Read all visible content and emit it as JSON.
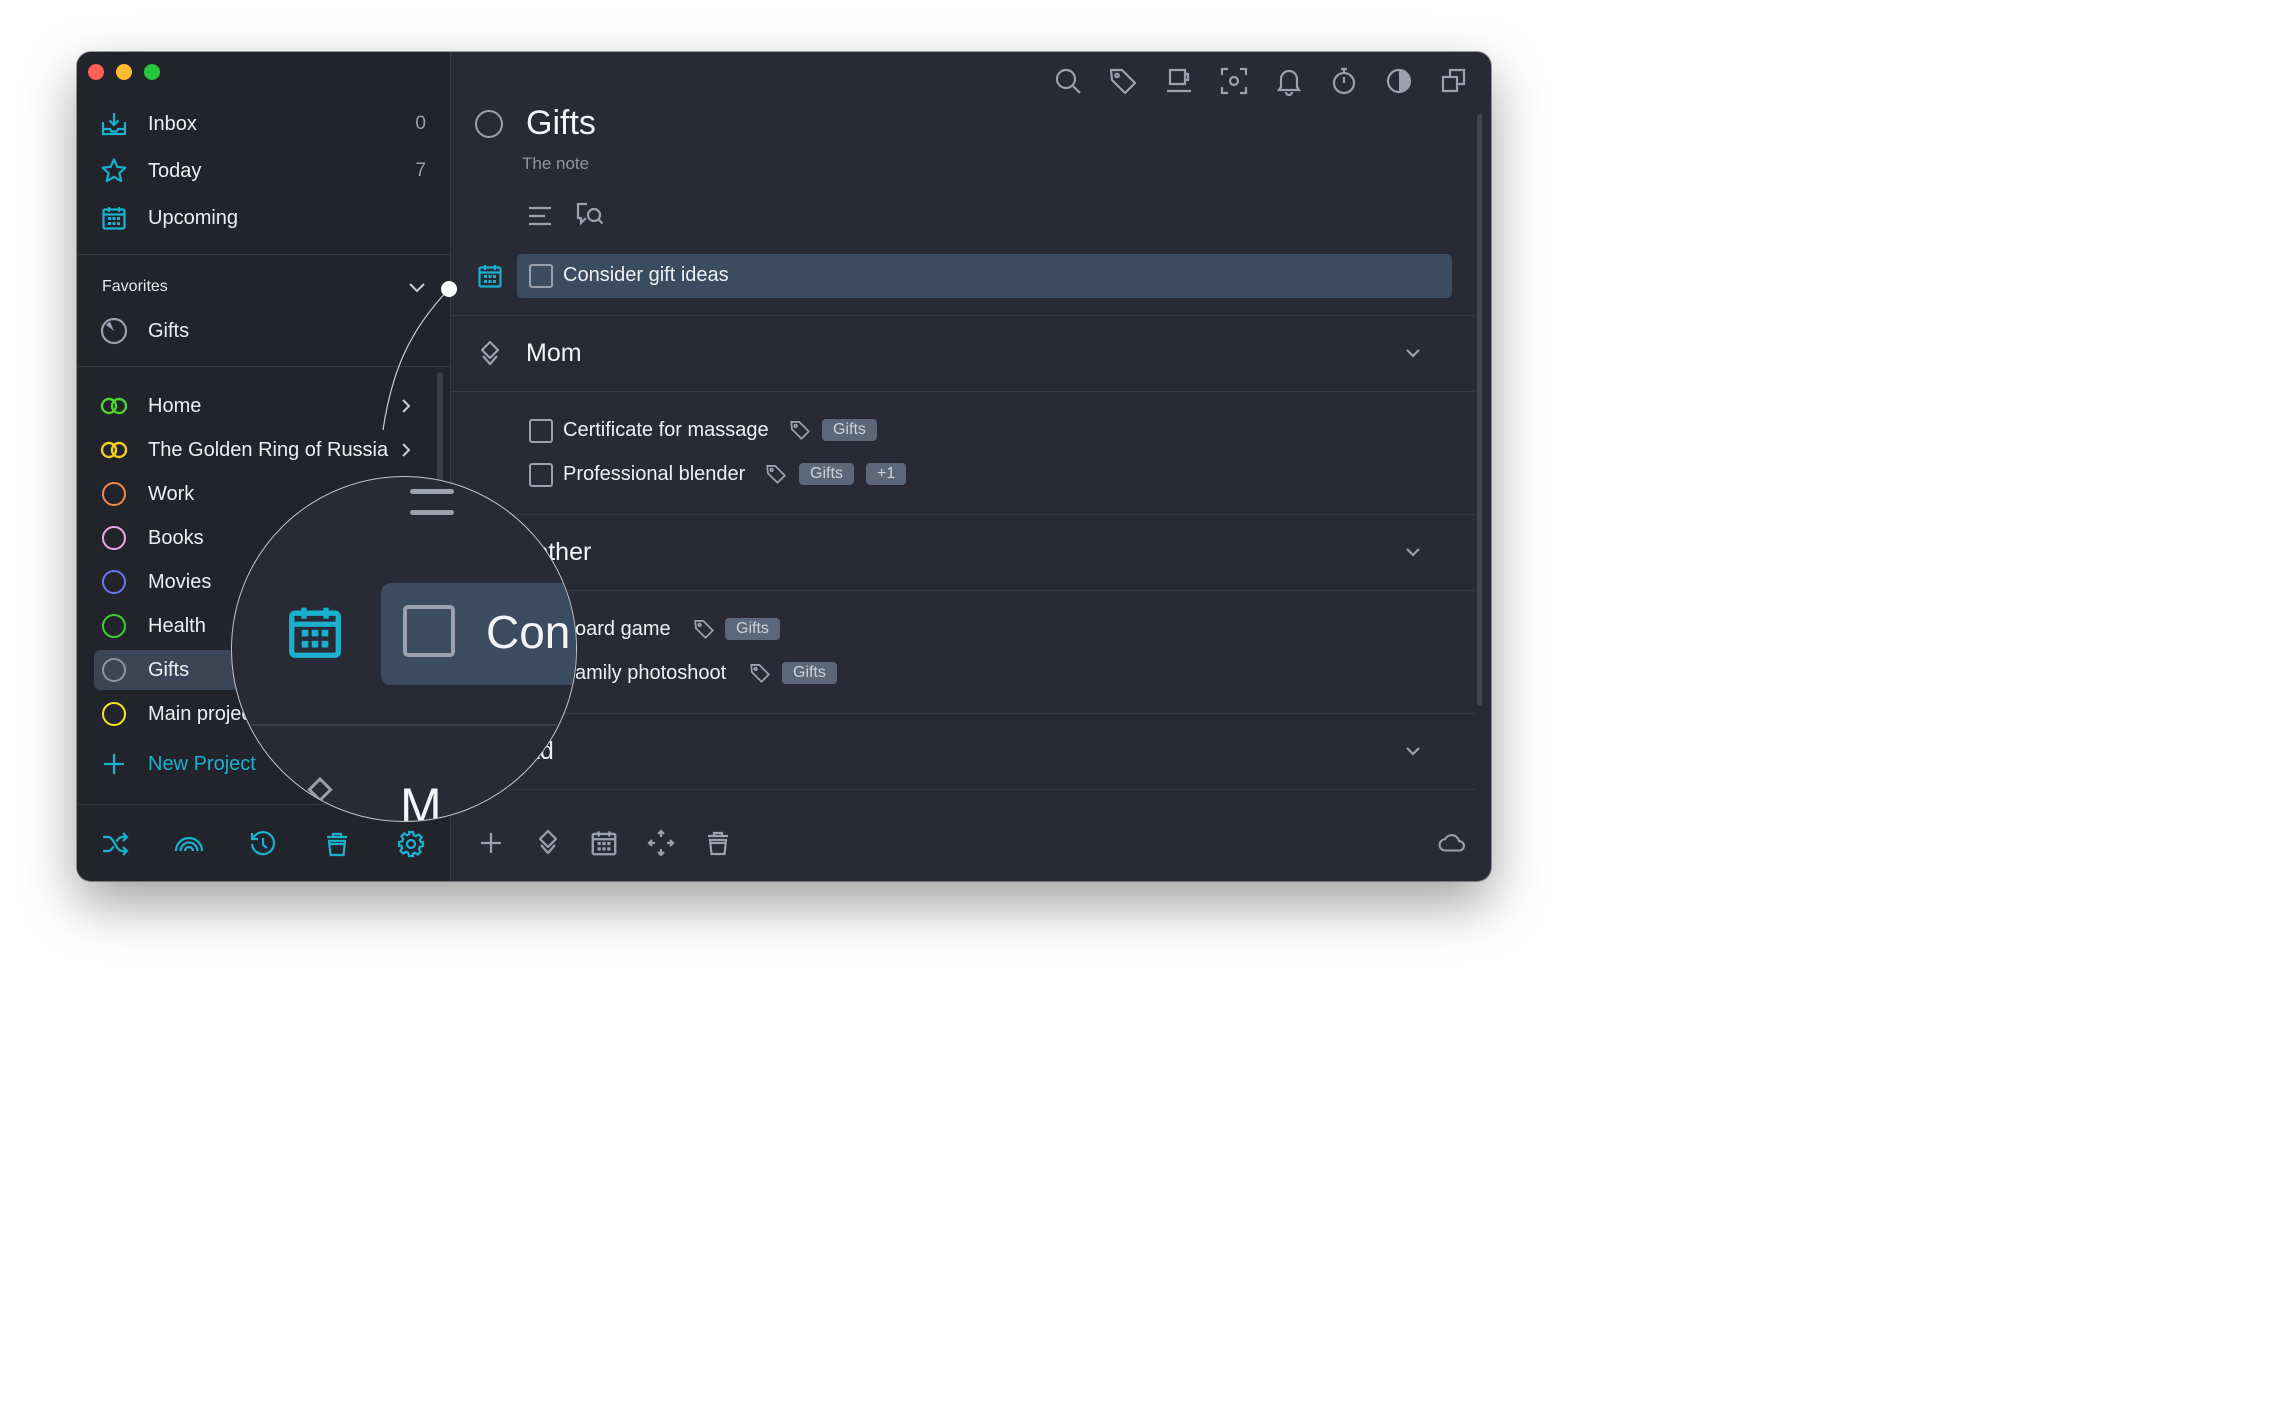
{
  "sidebar": {
    "inbox": {
      "label": "Inbox",
      "count": "0",
      "icon": "inbox-tray-icon"
    },
    "today": {
      "label": "Today",
      "count": "7",
      "icon": "star-icon"
    },
    "upcoming": {
      "label": "Upcoming",
      "icon": "calendar-icon"
    },
    "favorites_title": "Favorites",
    "favorites": [
      {
        "label": "Gifts",
        "icon": "progress-ring-icon"
      }
    ],
    "projects": [
      {
        "label": "Home",
        "icon": "area-rings-icon",
        "color": "#4fd12e"
      },
      {
        "label": "The Golden Ring of Russia",
        "icon": "area-rings-icon",
        "color": "#f3cc21"
      },
      {
        "label": "Work",
        "icon": "project-ring-icon",
        "color": "#f08a4b"
      },
      {
        "label": "Books",
        "icon": "project-ring-icon",
        "color": "#f2a8e6"
      },
      {
        "label": "Movies",
        "icon": "project-ring-icon",
        "color": "#6a75f0"
      },
      {
        "label": "Health",
        "icon": "project-ring-icon",
        "color": "#3fcf33"
      },
      {
        "label": "Gifts",
        "icon": "project-ring-icon",
        "color": "#8f95a2"
      },
      {
        "label": "Main project",
        "icon": "project-ring-icon",
        "color": "#f3ea1d"
      }
    ],
    "new_project": "New Project",
    "bottom_icons": [
      "shuffle-icon",
      "rainbow-icon",
      "history-icon",
      "trash-icon",
      "settings-gear-icon"
    ]
  },
  "toolbar": {
    "icons": [
      "search-icon",
      "tag-icon",
      "coffee-cup-icon",
      "focus-icon",
      "bell-icon",
      "timer-icon",
      "contrast-icon",
      "duplicate-icon"
    ]
  },
  "project": {
    "title": "Gifts",
    "note": "The note",
    "actions": [
      "list-icon",
      "chat-search-icon"
    ]
  },
  "tasks": {
    "top": {
      "title": "Consider gift ideas",
      "icon": "calendar-icon"
    },
    "groups": [
      {
        "name": "Mom",
        "items": [
          {
            "title": "Certificate for massage",
            "tags": [
              "Gifts"
            ]
          },
          {
            "title": "Professional blender",
            "tags": [
              "Gifts",
              "+1"
            ]
          }
        ]
      },
      {
        "name": "Brother",
        "visible_name": "rother",
        "items": [
          {
            "title": "Board game",
            "visible_title": "oard game",
            "tags": [
              "Gifts"
            ]
          },
          {
            "title": "Family photoshoot",
            "visible_title": "amily photoshoot",
            "tags": [
              "Gifts"
            ]
          }
        ]
      },
      {
        "name": "Dad",
        "visible_name": "ad",
        "items": []
      }
    ]
  },
  "bottombar": {
    "icons": [
      "add-icon",
      "heading-icon",
      "calendar-icon",
      "move-icon",
      "trash-icon",
      "cloud-icon"
    ]
  },
  "magnifier": {
    "task_text": "Con",
    "heading_text": "M"
  },
  "colors": {
    "accent": "#1bb0cf",
    "sidebar_bg": "#22242c",
    "main_bg": "#282b36",
    "selection": "#3b4b60"
  }
}
